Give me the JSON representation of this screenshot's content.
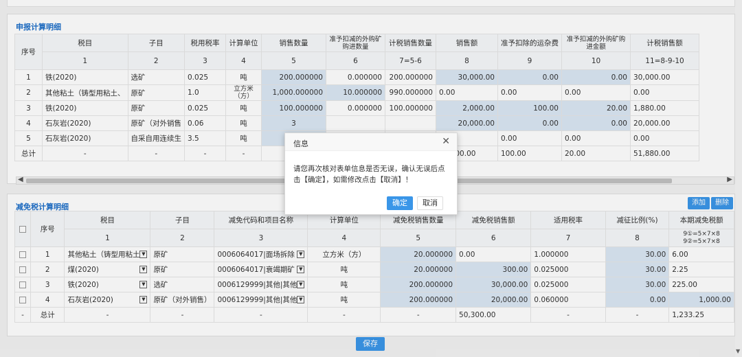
{
  "section1": {
    "title": "申报计算明细",
    "headers_top": [
      "序号",
      "税目",
      "子目",
      "税用税率",
      "计算单位",
      "销售数量",
      "准予扣减的外购矿购进数量",
      "计税销售数量",
      "销售额",
      "准予扣除的运杂费",
      "准予扣减的外购矿购进金额",
      "计税销售额"
    ],
    "headers_num": [
      "1",
      "2",
      "3",
      "4",
      "5",
      "6",
      "7=5-6",
      "8",
      "9",
      "10",
      "11=8-9-10"
    ],
    "rows": [
      {
        "no": "1",
        "item": "铁(2020)",
        "sub": "选矿",
        "rate": "0.025",
        "unit": "吨",
        "qty": "200.000000",
        "deduct_qty": "0.000000",
        "tax_qty": "200.000000",
        "sales": "30,000.00",
        "freight": "0.00",
        "deduct_amt": "0.00",
        "tax_sales": "30,000.00"
      },
      {
        "no": "2",
        "item": "其他粘土（铸型用粘土、",
        "sub": "原矿",
        "rate": "1.0",
        "unit": "立方米（方）",
        "qty": "1,000.000000",
        "deduct_qty": "10.000000",
        "tax_qty": "990.000000",
        "sales": "0.00",
        "freight": "0.00",
        "deduct_amt": "0.00",
        "tax_sales": "0.00"
      },
      {
        "no": "3",
        "item": "铁(2020)",
        "sub": "原矿",
        "rate": "0.025",
        "unit": "吨",
        "qty": "100.000000",
        "deduct_qty": "0.000000",
        "tax_qty": "100.000000",
        "sales": "2,000.00",
        "freight": "100.00",
        "deduct_amt": "20.00",
        "tax_sales": "1,880.00"
      },
      {
        "no": "4",
        "item": "石灰岩(2020)",
        "sub": "原矿（对外销售",
        "rate": "0.06",
        "unit": "吨",
        "qty": "3",
        "deduct_qty": "",
        "tax_qty": "",
        "sales": "20,000.00",
        "freight": "0.00",
        "deduct_amt": "0.00",
        "tax_sales": "20,000.00"
      },
      {
        "no": "5",
        "item": "石灰岩(2020)",
        "sub": "自采自用连续生",
        "rate": "3.5",
        "unit": "吨",
        "qty": "9",
        "deduct_qty": "",
        "tax_qty": "",
        "sales": "0.00",
        "freight": "0.00",
        "deduct_amt": "0.00",
        "tax_sales": "0.00"
      }
    ],
    "total": {
      "label": "总计",
      "dash": "-",
      "sales": "52,000.00",
      "freight": "100.00",
      "deduct_amt": "20.00",
      "tax_sales": "51,880.00"
    }
  },
  "section2": {
    "title": "减免税计算明细",
    "add_label": "添加",
    "delete_label": "删除",
    "headers_top": [
      "序号",
      "税目",
      "子目",
      "减免代码和项目名称",
      "计算单位",
      "减免税销售数量",
      "减免税销售额",
      "适用税率",
      "减征比例(%)",
      "本期减免税额"
    ],
    "headers_num": [
      "1",
      "2",
      "3",
      "4",
      "5",
      "6",
      "7",
      "8",
      "9①=5×7×8",
      "9②=5×7×8"
    ],
    "rows": [
      {
        "no": "1",
        "item": "其他粘土（铸型用粘土",
        "sub": "原矿",
        "code": "0006064017|面场拆除",
        "unit": "立方米（方）",
        "qty": "20.000000",
        "amt": "0.00",
        "rate": "1.000000",
        "ratio": "30.00",
        "relief": "6.00"
      },
      {
        "no": "2",
        "item": "煤(2020)",
        "sub": "原矿",
        "code": "0006064017|衰竭期矿",
        "unit": "吨",
        "qty": "20.000000",
        "amt": "300.00",
        "rate": "0.025000",
        "ratio": "30.00",
        "relief": "2.25"
      },
      {
        "no": "3",
        "item": "铁(2020)",
        "sub": "选矿",
        "code": "0006129999|其他|其他",
        "unit": "吨",
        "qty": "200.000000",
        "amt": "30,000.00",
        "rate": "0.025000",
        "ratio": "30.00",
        "relief": "225.00"
      },
      {
        "no": "4",
        "item": "石灰岩(2020)",
        "sub": "原矿（对外销售）",
        "code": "0006129999|其他|其他",
        "unit": "吨",
        "qty": "200.000000",
        "amt": "20,000.00",
        "rate": "0.060000",
        "ratio": "0.00",
        "relief": "1,000.00"
      }
    ],
    "total": {
      "dash": "-",
      "label": "总计",
      "amt": "50,300.00",
      "relief": "1,233.25"
    }
  },
  "save_label": "保存",
  "dialog": {
    "title": "信息",
    "message": "请您再次核对表单信息是否无误，确认无误后点击【确定】，如需修改点击【取消】！",
    "ok_label": "确定",
    "cancel_label": "取消"
  },
  "colors": {
    "accent": "#3a96e8",
    "highlight": "#dbe7f4",
    "title": "#1e6fc9"
  }
}
